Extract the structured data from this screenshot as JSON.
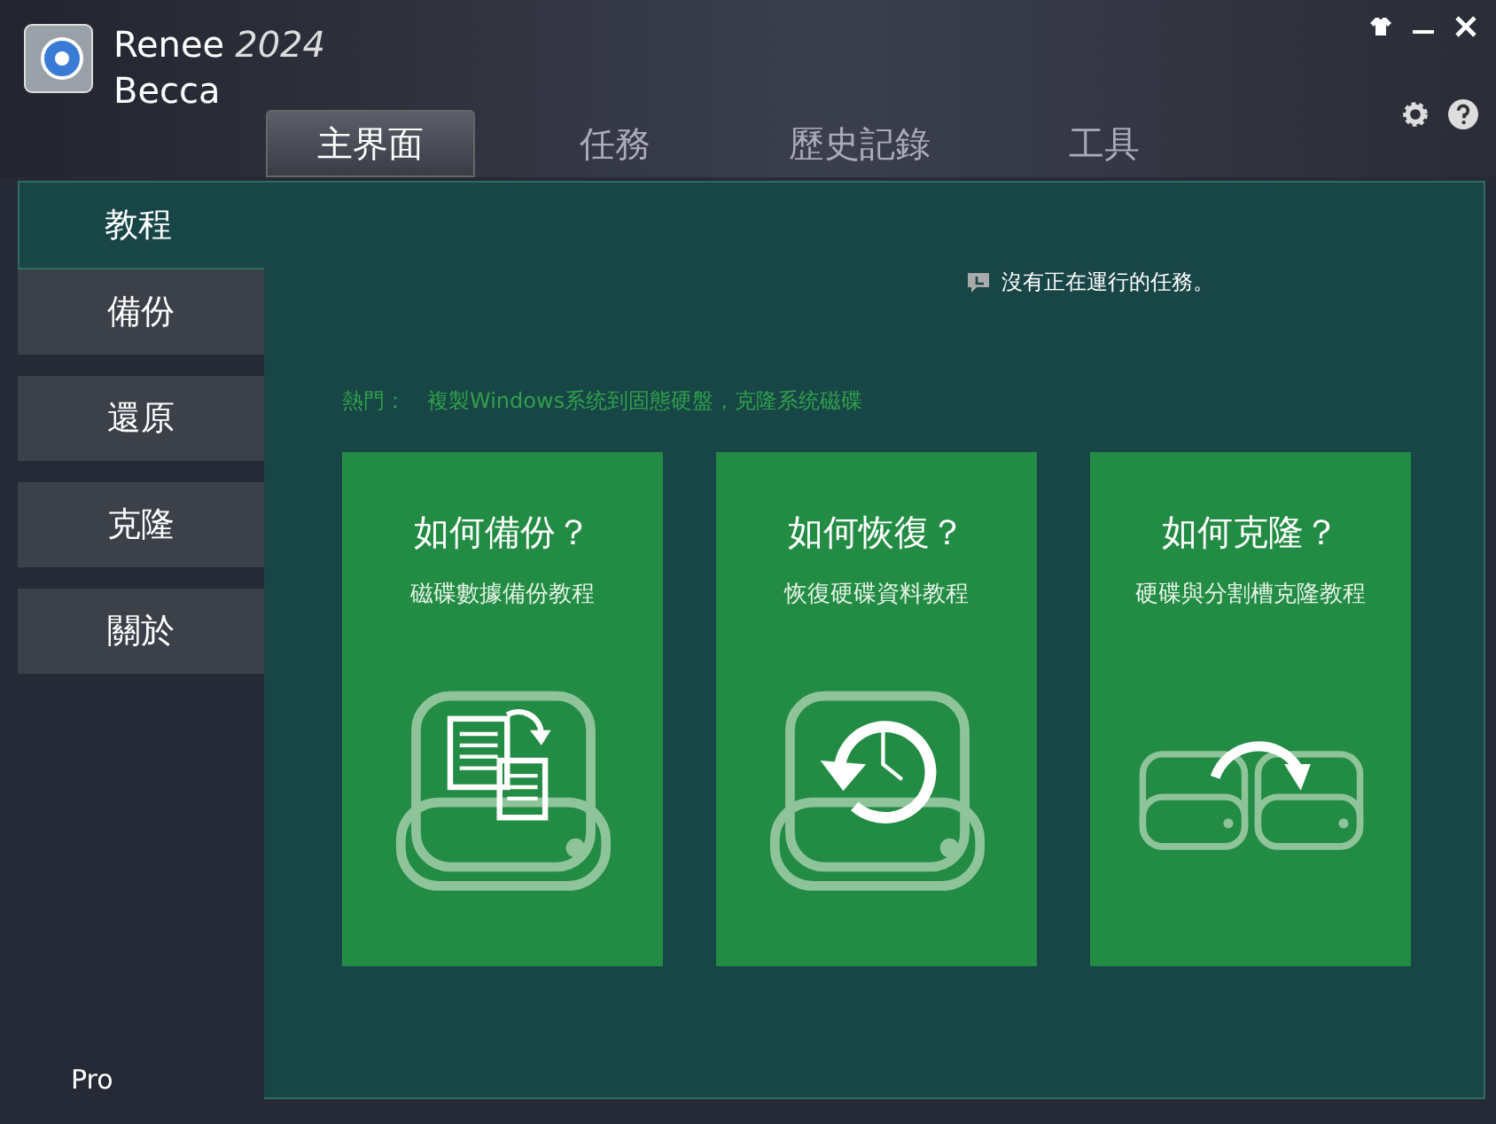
{
  "app": {
    "name": "Renee",
    "year": "2024",
    "subname": "Becca",
    "edition": "Pro"
  },
  "tabs": [
    {
      "label": "主界面",
      "selected": true
    },
    {
      "label": "任務",
      "selected": false
    },
    {
      "label": "歷史記錄",
      "selected": false
    },
    {
      "label": "工具",
      "selected": false
    }
  ],
  "sidebar": {
    "items": [
      {
        "label": "教程",
        "selected": true
      },
      {
        "label": "備份",
        "selected": false
      },
      {
        "label": "還原",
        "selected": false
      },
      {
        "label": "克隆",
        "selected": false
      },
      {
        "label": "關於",
        "selected": false
      }
    ]
  },
  "status": "沒有正在運行的任務。",
  "hot": {
    "label": "熱門：",
    "text": "複製Windows系统到固態硬盤，克隆系统磁碟"
  },
  "cards": [
    {
      "kind": "backup",
      "title": "如何備份？",
      "subtitle": "磁碟數據備份教程"
    },
    {
      "kind": "restore",
      "title": "如何恢復？",
      "subtitle": "恢復硬碟資料教程"
    },
    {
      "kind": "clone",
      "title": "如何克隆？",
      "subtitle": "硬碟與分割槽克隆教程"
    }
  ]
}
